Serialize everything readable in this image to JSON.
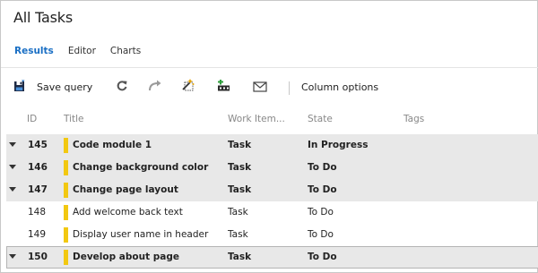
{
  "page": {
    "title": "All Tasks"
  },
  "tabs": [
    {
      "label": "Results",
      "active": true
    },
    {
      "label": "Editor",
      "active": false
    },
    {
      "label": "Charts",
      "active": false
    }
  ],
  "toolbar": {
    "save_query": "Save query",
    "column_options": "Column options",
    "icons": [
      "save-icon",
      "refresh-icon",
      "redo-icon",
      "edit-wand-icon",
      "add-to-backlog-icon",
      "mail-icon"
    ]
  },
  "columns": {
    "id": "ID",
    "title": "Title",
    "work_item_type": "Work Item...",
    "state": "State",
    "tags": "Tags"
  },
  "colors": {
    "accent": "#1a6fc4",
    "task_bar": "#f2c811",
    "selected_row": "#e8e8e8"
  },
  "rows": [
    {
      "id": "145",
      "title": "Code module 1",
      "type": "Task",
      "state": "In Progress",
      "tags": ""
    },
    {
      "id": "146",
      "title": "Change background color",
      "type": "Task",
      "state": "To Do",
      "tags": ""
    },
    {
      "id": "147",
      "title": "Change page layout",
      "type": "Task",
      "state": "To Do",
      "tags": ""
    },
    {
      "id": "148",
      "title": "Add welcome back text",
      "type": "Task",
      "state": "To Do",
      "tags": ""
    },
    {
      "id": "149",
      "title": "Display user name in header",
      "type": "Task",
      "state": "To Do",
      "tags": ""
    },
    {
      "id": "150",
      "title": "Develop about page",
      "type": "Task",
      "state": "To Do",
      "tags": ""
    }
  ]
}
